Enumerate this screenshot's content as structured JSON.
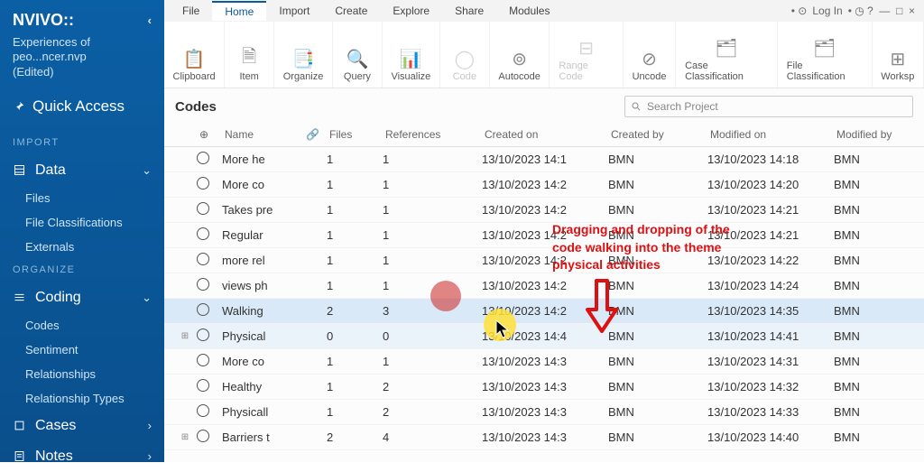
{
  "brand": "NVIVO::",
  "project": {
    "name": "Experiences of peo...ncer.nvp",
    "status": "(Edited)"
  },
  "sidebar": {
    "quick_access": "Quick Access",
    "sections": [
      "IMPORT",
      "ORGANIZE"
    ],
    "groups": [
      {
        "label": "Data",
        "items": [
          "Files",
          "File Classifications",
          "Externals"
        ]
      },
      {
        "label": "Coding",
        "items": [
          "Codes",
          "Sentiment",
          "Relationships",
          "Relationship Types"
        ]
      },
      {
        "label": "Cases",
        "items": []
      },
      {
        "label": "Notes",
        "items": []
      }
    ]
  },
  "menu": [
    "File",
    "Home",
    "Import",
    "Create",
    "Explore",
    "Share",
    "Modules"
  ],
  "menu_right": {
    "login": "Log In"
  },
  "ribbon": [
    "Clipboard",
    "Item",
    "Organize",
    "Query",
    "Visualize",
    "Code",
    "Autocode",
    "Range Code",
    "Uncode",
    "Case Classification",
    "File Classification",
    "Worksp"
  ],
  "list": {
    "title": "Codes",
    "search_placeholder": "Search Project",
    "columns": [
      "Name",
      "Files",
      "References",
      "Created on",
      "Created by",
      "Modified on",
      "Modified by"
    ],
    "rows": [
      {
        "exp": "",
        "name": "More he",
        "files": "1",
        "refs": "1",
        "con": "13/10/2023 14:1",
        "cby": "BMN",
        "mon": "13/10/2023 14:18",
        "mby": "BMN",
        "sel": ""
      },
      {
        "exp": "",
        "name": "More co",
        "files": "1",
        "refs": "1",
        "con": "13/10/2023 14:2",
        "cby": "BMN",
        "mon": "13/10/2023 14:20",
        "mby": "BMN",
        "sel": ""
      },
      {
        "exp": "",
        "name": "Takes pre",
        "files": "1",
        "refs": "1",
        "con": "13/10/2023 14:2",
        "cby": "BMN",
        "mon": "13/10/2023 14:21",
        "mby": "BMN",
        "sel": ""
      },
      {
        "exp": "",
        "name": "Regular",
        "files": "1",
        "refs": "1",
        "con": "13/10/2023 14:2",
        "cby": "BMN",
        "mon": "13/10/2023 14:21",
        "mby": "BMN",
        "sel": ""
      },
      {
        "exp": "",
        "name": "more rel",
        "files": "1",
        "refs": "1",
        "con": "13/10/2023 14:2",
        "cby": "BMN",
        "mon": "13/10/2023 14:22",
        "mby": "BMN",
        "sel": ""
      },
      {
        "exp": "",
        "name": "views ph",
        "files": "1",
        "refs": "1",
        "con": "13/10/2023 14:2",
        "cby": "BMN",
        "mon": "13/10/2023 14:24",
        "mby": "BMN",
        "sel": ""
      },
      {
        "exp": "",
        "name": "Walking",
        "files": "2",
        "refs": "3",
        "con": "13/10/2023 14:2",
        "cby": "BMN",
        "mon": "13/10/2023 14:35",
        "mby": "BMN",
        "sel": "sel"
      },
      {
        "exp": "⊞",
        "name": "Physical",
        "files": "0",
        "refs": "0",
        "con": "13/10/2023 14:4",
        "cby": "BMN",
        "mon": "13/10/2023 14:41",
        "mby": "BMN",
        "sel": "hi"
      },
      {
        "exp": "",
        "name": "More co",
        "files": "1",
        "refs": "1",
        "con": "13/10/2023 14:3",
        "cby": "BMN",
        "mon": "13/10/2023 14:31",
        "mby": "BMN",
        "sel": ""
      },
      {
        "exp": "",
        "name": "Healthy",
        "files": "1",
        "refs": "2",
        "con": "13/10/2023 14:3",
        "cby": "BMN",
        "mon": "13/10/2023 14:32",
        "mby": "BMN",
        "sel": ""
      },
      {
        "exp": "",
        "name": "Physicall",
        "files": "1",
        "refs": "2",
        "con": "13/10/2023 14:3",
        "cby": "BMN",
        "mon": "13/10/2023 14:33",
        "mby": "BMN",
        "sel": ""
      },
      {
        "exp": "⊞",
        "name": "Barriers t",
        "files": "2",
        "refs": "4",
        "con": "13/10/2023 14:3",
        "cby": "BMN",
        "mon": "13/10/2023 14:40",
        "mby": "BMN",
        "sel": ""
      }
    ]
  },
  "annotation": {
    "line1": "Dragging and dropping of the",
    "line2": "code walking into the theme",
    "line3": "physical activities"
  }
}
